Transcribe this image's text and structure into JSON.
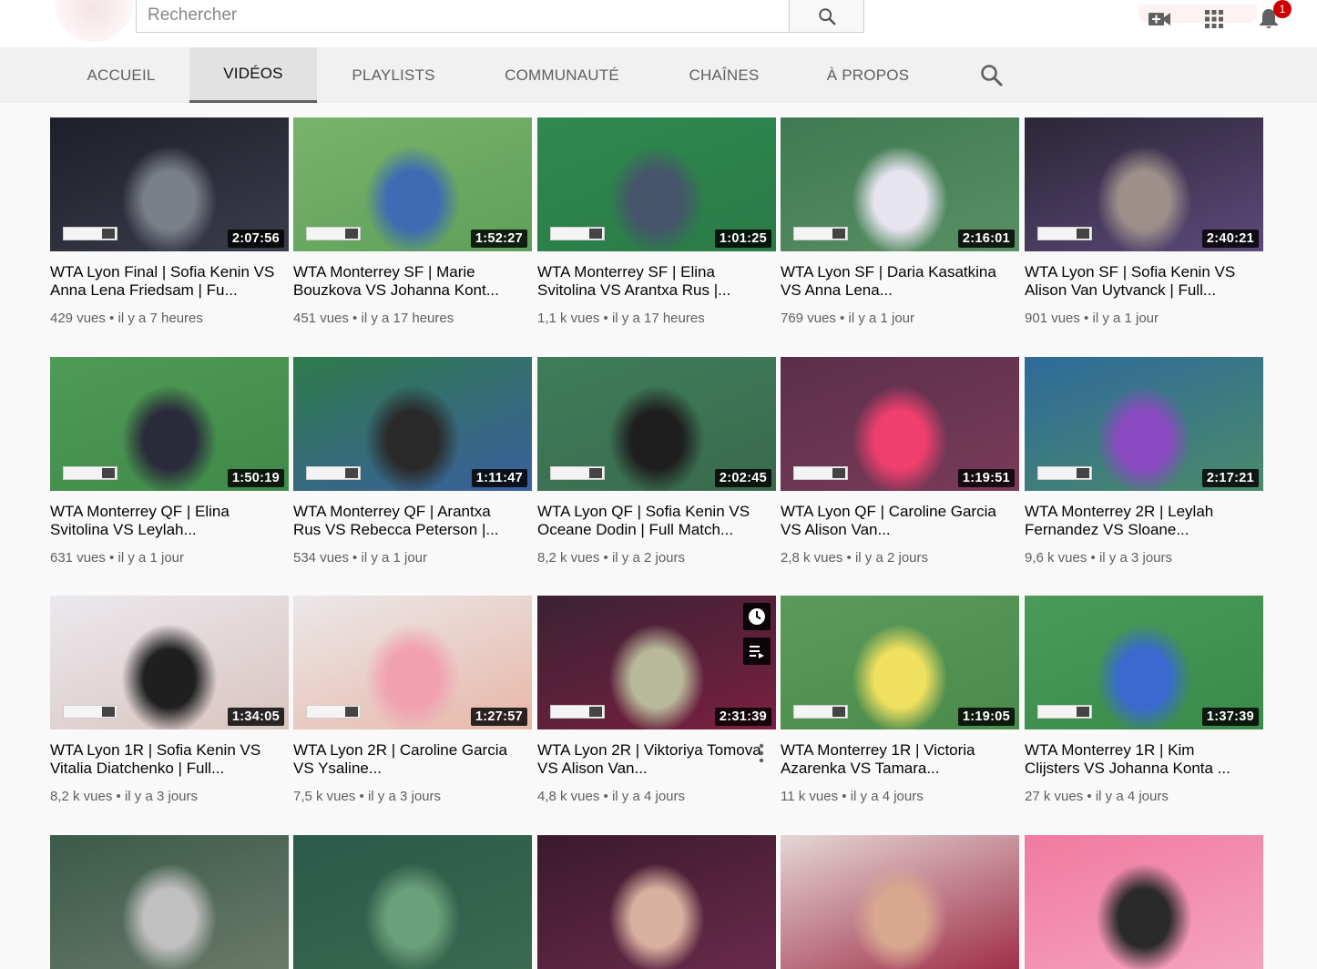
{
  "search": {
    "placeholder": "Rechercher"
  },
  "notifications": {
    "count": "1"
  },
  "tabs": [
    {
      "label": "ACCUEIL"
    },
    {
      "label": "VIDÉOS",
      "active": true
    },
    {
      "label": "PLAYLISTS"
    },
    {
      "label": "COMMUNAUTÉ"
    },
    {
      "label": "CHAÎNES"
    },
    {
      "label": "À PROPOS"
    }
  ],
  "videos": [
    {
      "title": "WTA Lyon Final | Sofia Kenin VS Anna Lena Friedsam | Fu...",
      "views": "429 vues",
      "age": "il y a 7 heures",
      "duration": "2:07:56",
      "colors": [
        "#1d1f2a",
        "#3a3d4a",
        "#7a7f8a"
      ]
    },
    {
      "title": "WTA Monterrey SF | Marie Bouzkova VS Johanna Kont...",
      "views": "451 vues",
      "age": "il y a 17 heures",
      "duration": "1:52:27",
      "colors": [
        "#79b36a",
        "#5ea05a",
        "#3d6bb4"
      ]
    },
    {
      "title": "WTA Monterrey SF | Elina Svitolina VS Arantxa Rus |...",
      "views": "1,1 k vues",
      "age": "il y a 17 heures",
      "duration": "1:01:25",
      "colors": [
        "#2f8a4f",
        "#2a7a47",
        "#45556a"
      ]
    },
    {
      "title": "WTA Lyon SF | Daria Kasatkina VS Anna Lena...",
      "views": "769 vues",
      "age": "il y a 1 jour",
      "duration": "2:16:01",
      "colors": [
        "#3e7a52",
        "#5a8f64",
        "#e6e4ef"
      ]
    },
    {
      "title": "WTA Lyon SF | Sofia Kenin VS Alison Van Uytvanck | Full...",
      "views": "901 vues",
      "age": "il y a 1 jour",
      "duration": "2:40:21",
      "colors": [
        "#2b2636",
        "#5b4a7a",
        "#9d8f8a"
      ]
    },
    {
      "title": "WTA Monterrey QF | Elina Svitolina VS Leylah...",
      "views": "631 vues",
      "age": "il y a 1 jour",
      "duration": "1:50:19",
      "colors": [
        "#4f9a55",
        "#3f8a4a",
        "#2a2a3a"
      ]
    },
    {
      "title": "WTA Monterrey QF | Arantxa Rus VS Rebecca Peterson |...",
      "views": "534 vues",
      "age": "il y a 1 jour",
      "duration": "1:11:47",
      "colors": [
        "#2f7a4a",
        "#3a5fa0",
        "#2a2a2a"
      ]
    },
    {
      "title": "WTA Lyon QF | Sofia Kenin VS Oceane Dodin | Full Match...",
      "views": "8,2 k vues",
      "age": "il y a 2 jours",
      "duration": "2:02:45",
      "colors": [
        "#3e7d5a",
        "#3a6a4e",
        "#1e1e1e"
      ]
    },
    {
      "title": "WTA Lyon QF | Caroline Garcia VS Alison Van...",
      "views": "2,8 k vues",
      "age": "il y a 2 jours",
      "duration": "1:19:51",
      "colors": [
        "#5a2f4a",
        "#7a3b58",
        "#ef3f6f"
      ]
    },
    {
      "title": "WTA Monterrey 2R | Leylah Fernandez VS Sloane...",
      "views": "9,6 k vues",
      "age": "il y a 3 jours",
      "duration": "2:17:21",
      "colors": [
        "#2f6a9a",
        "#4a8a6a",
        "#8a4ac0"
      ]
    },
    {
      "title": "WTA Lyon 1R | Sofia Kenin VS Vitalia Diatchenko | Full...",
      "views": "8,2 k vues",
      "age": "il y a 3 jours",
      "duration": "1:34:05",
      "colors": [
        "#ebe9ee",
        "#d9c4c0",
        "#1f1f1f"
      ]
    },
    {
      "title": "WTA Lyon 2R | Caroline Garcia VS Ysaline...",
      "views": "7,5 k vues",
      "age": "il y a 3 jours",
      "duration": "1:27:57",
      "colors": [
        "#ebe8ea",
        "#e7b7a7",
        "#f1a0b0"
      ]
    },
    {
      "title": "WTA Lyon 2R | Viktoriya Tomova VS Alison Van...",
      "views": "4,8 k vues",
      "age": "il y a 4 jours",
      "duration": "2:31:39",
      "colors": [
        "#3a2232",
        "#7a2040",
        "#b8b89a"
      ]
    },
    {
      "title": "WTA Monterrey 1R | Victoria Azarenka VS Tamara...",
      "views": "11 k vues",
      "age": "il y a 4 jours",
      "duration": "1:19:05",
      "colors": [
        "#5a9a5a",
        "#4a8a4a",
        "#f0e060"
      ]
    },
    {
      "title": "WTA Monterrey 1R | Kim Clijsters VS Johanna Konta ...",
      "views": "27 k vues",
      "age": "il y a 4 jours",
      "duration": "1:37:39",
      "colors": [
        "#4a9a5a",
        "#3a8a4a",
        "#3a6ad0"
      ]
    },
    {
      "colors": [
        "#3a5a4a",
        "#6a7a6a",
        "#c0c0c0"
      ]
    },
    {
      "colors": [
        "#2a5a4a",
        "#3a6a50",
        "#6aa07a"
      ]
    },
    {
      "colors": [
        "#3a1a2a",
        "#6a2a4a",
        "#d8b0a0"
      ]
    },
    {
      "colors": [
        "#e4d6d6",
        "#a0304a",
        "#d9a790"
      ]
    },
    {
      "colors": [
        "#f07aa0",
        "#f5a3bf",
        "#2a2a2a"
      ]
    }
  ]
}
